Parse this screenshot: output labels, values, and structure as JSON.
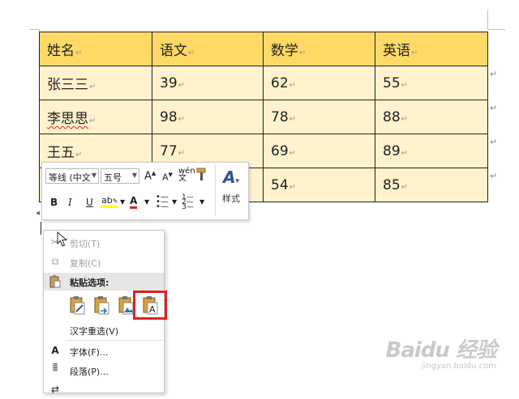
{
  "table": {
    "headers": [
      "姓名",
      "语文",
      "数学",
      "英语"
    ],
    "rows": [
      [
        "张三三",
        "39",
        "62",
        "55"
      ],
      [
        "李思思",
        "98",
        "78",
        "88"
      ],
      [
        "王五",
        "77",
        "69",
        "89"
      ],
      [
        "",
        "",
        "54",
        "85"
      ]
    ],
    "paragraph_mark": "↵"
  },
  "mini_toolbar": {
    "font_name": "等线 (中文",
    "font_size": "五号",
    "bold": "B",
    "italic": "I",
    "underline": "U",
    "font_color_label": "A",
    "styles_label": "样式"
  },
  "context_menu": {
    "cut": "剪切(T)",
    "copy": "复制(C)",
    "paste_options": "粘贴选项:",
    "reconvert": "汉字重选(V)",
    "font": "字体(F)...",
    "paragraph": "段落(P)..."
  },
  "watermark": {
    "logo": "Baidu 经验",
    "url": "jingyan.baidu.com"
  },
  "colors": {
    "header_fill": "#ffd966",
    "cell_fill": "#fff2cc",
    "highlight_box": "#e02020"
  }
}
